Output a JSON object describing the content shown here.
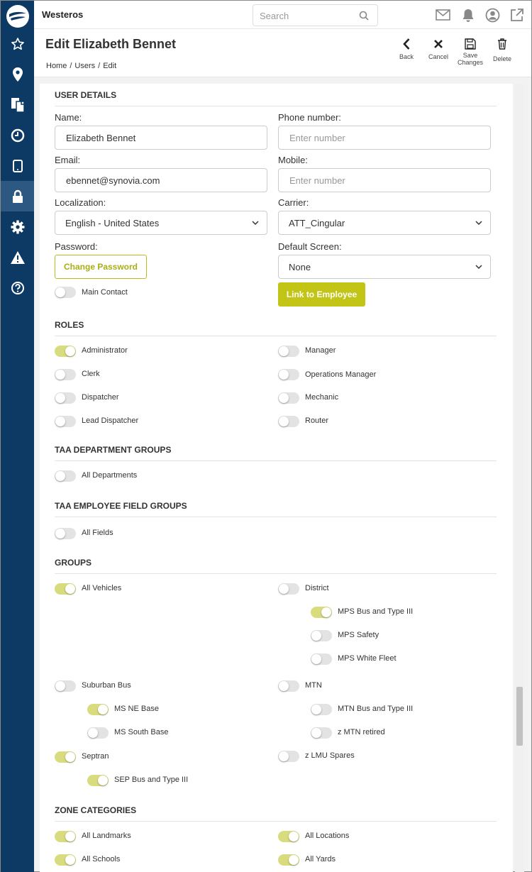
{
  "app": {
    "name": "Westeros"
  },
  "search": {
    "placeholder": "Search",
    "value": ""
  },
  "page": {
    "title": "Edit Elizabeth Bennet",
    "breadcrumb": [
      "Home",
      "/",
      "Users",
      "/",
      "Edit"
    ]
  },
  "actions": {
    "back": "Back",
    "cancel": "Cancel",
    "save_line1": "Save",
    "save_line2": "Changes",
    "delete": "Delete"
  },
  "user_details": {
    "heading": "USER DETAILS",
    "name_label": "Name:",
    "name_value": "Elizabeth Bennet",
    "phone_label": "Phone number:",
    "phone_placeholder": "Enter number",
    "email_label": "Email:",
    "email_value": "ebennet@synovia.com",
    "mobile_label": "Mobile:",
    "mobile_placeholder": "Enter number",
    "localization_label": "Localization:",
    "localization_value": "English - United States",
    "carrier_label": "Carrier:",
    "carrier_value": "ATT_Cingular",
    "password_label": "Password:",
    "change_password": "Change Password",
    "default_screen_label": "Default Screen:",
    "default_screen_value": "None",
    "link_employee": "Link to Employee",
    "main_contact": {
      "label": "Main Contact",
      "on": false
    }
  },
  "roles": {
    "heading": "ROLES",
    "items": [
      {
        "label": "Administrator",
        "on": true
      },
      {
        "label": "Manager",
        "on": false
      },
      {
        "label": "Clerk",
        "on": false
      },
      {
        "label": "Operations Manager",
        "on": false
      },
      {
        "label": "Dispatcher",
        "on": false
      },
      {
        "label": "Mechanic",
        "on": false
      },
      {
        "label": "Lead Dispatcher",
        "on": false
      },
      {
        "label": "Router",
        "on": false
      }
    ]
  },
  "taa_departments": {
    "heading": "TAA DEPARTMENT GROUPS",
    "items": [
      {
        "label": "All Departments",
        "on": false
      }
    ]
  },
  "taa_employee_fields": {
    "heading": "TAA EMPLOYEE FIELD GROUPS",
    "items": [
      {
        "label": "All Fields",
        "on": false
      }
    ]
  },
  "groups": {
    "heading": "GROUPS",
    "items": [
      {
        "label": "All Vehicles",
        "on": true
      },
      {
        "label": "District",
        "on": false
      },
      {
        "label": "MPS Bus and Type III",
        "on": true
      },
      {
        "label": "MPS Safety",
        "on": false
      },
      {
        "label": "MPS White Fleet",
        "on": false
      },
      {
        "label": "Suburban Bus",
        "on": false
      },
      {
        "label": "MTN",
        "on": false
      },
      {
        "label": "MS NE Base",
        "on": true
      },
      {
        "label": "MTN Bus and Type III",
        "on": false
      },
      {
        "label": "MS South Base",
        "on": false
      },
      {
        "label": "z MTN retired",
        "on": false
      },
      {
        "label": "Septran",
        "on": true
      },
      {
        "label": "z LMU Spares",
        "on": false
      },
      {
        "label": "SEP Bus and Type III",
        "on": true
      }
    ]
  },
  "zone_categories": {
    "heading": "ZONE CATEGORIES",
    "items": [
      {
        "label": "All Landmarks",
        "on": true
      },
      {
        "label": "All Locations",
        "on": true
      },
      {
        "label": "All Schools",
        "on": true
      },
      {
        "label": "All Yards",
        "on": true
      }
    ]
  },
  "colors": {
    "sidebar": "#0d3a64",
    "sidebar_active": "#2d5881",
    "accent": "#c2c416",
    "toggle_on": "#d9dc7e",
    "toggle_off": "#e3e3e3"
  },
  "icons": {
    "sidebar": [
      "star-icon",
      "map-pin-icon",
      "documents-icon",
      "clock-icon",
      "tablet-icon",
      "lock-icon",
      "gear-icon",
      "warning-icon",
      "help-icon"
    ],
    "top": [
      "mail-icon",
      "bell-icon",
      "user-icon",
      "external-link-icon"
    ]
  }
}
